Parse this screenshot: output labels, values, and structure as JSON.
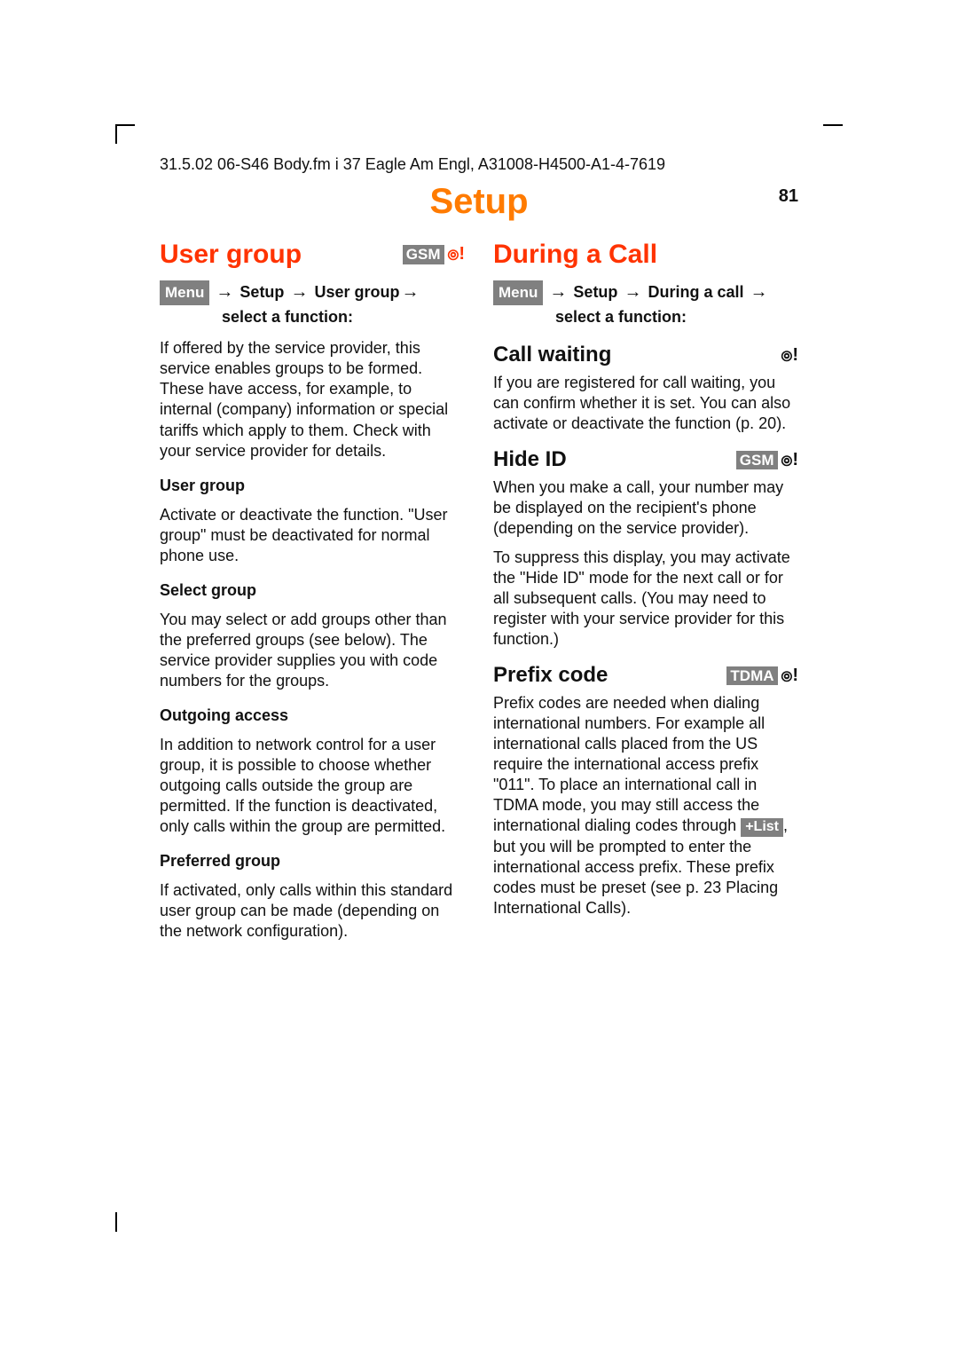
{
  "header": "31.5.02    06-S46 Body.fm    i 37 Eagle  Am Engl, A31008-H4500-A1-4-7619",
  "page_title": "Setup",
  "page_number": "81",
  "badges": {
    "gsm": "GSM",
    "tdma": "TDMA"
  },
  "buttons": {
    "menu": "Menu",
    "plus_list": "+List"
  },
  "arrow": "→",
  "left": {
    "section_title": "User group",
    "nav_setup": "Setup",
    "nav_user_group": "User group",
    "nav_select": "select a function:",
    "p1": "If offered by the service provider, this service enables groups to be formed. These have access, for example, to internal (company) information or special tariffs which apply to them. Check with your service provider for details.",
    "h_user_group": "User group",
    "p_user_group": "Activate or deactivate the function. \"User group\" must be deactivated for normal phone use.",
    "h_select_group": "Select group",
    "p_select_group": "You may select or add groups other than the preferred groups (see below). The service provider supplies you with code numbers for the groups.",
    "h_outgoing": "Outgoing access",
    "p_outgoing": "In addition to network control for a user group, it is possible to choose whether outgoing calls outside the group are permitted. If the function is deactivated, only calls within the group are permitted.",
    "h_preferred": "Preferred group",
    "p_preferred": "If activated, only calls within this standard user group can be made (depending on the network configuration)."
  },
  "right": {
    "section_title": "During a Call",
    "nav_setup": "Setup",
    "nav_during": "During a call",
    "nav_select": "select a function:",
    "h_call_waiting": "Call waiting",
    "p_call_waiting": "If you are registered for call waiting, you can confirm whether it is set. You can also activate or deactivate the function (p. 20).",
    "h_hide_id": "Hide ID",
    "p_hide_id1": "When you make a call, your number may be displayed on the recipient's phone (depending on the service provider).",
    "p_hide_id2": "To suppress this display, you may activate the \"Hide ID\" mode for the next call or for all subsequent calls. (You may need to register with your service provider for this function.)",
    "h_prefix": "Prefix code",
    "p_prefix_a": "Prefix codes are needed when dialing international numbers.  For example all international calls placed from the US require the international access prefix \"011\".  To place an international call in TDMA mode, you may still access the international dialing codes through ",
    "p_prefix_b": ", but you will be prompted to enter the international access prefix.  These prefix codes must be preset (see p. 23 Placing International Calls)."
  }
}
